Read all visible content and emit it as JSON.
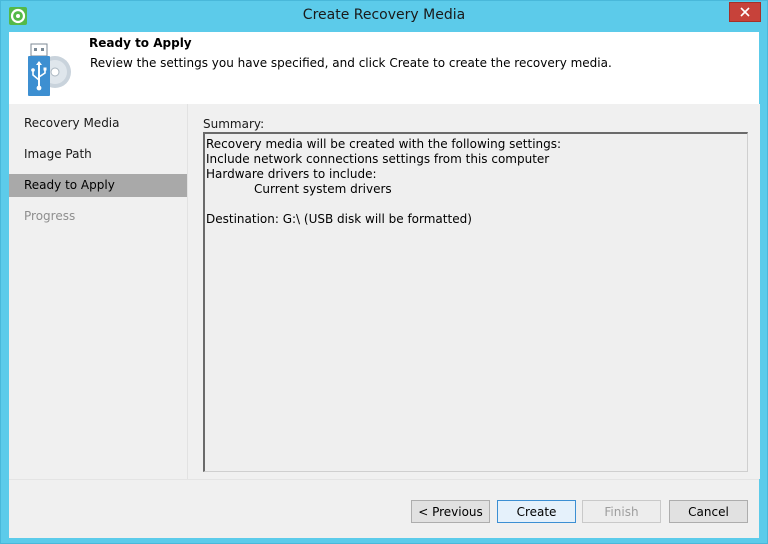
{
  "window": {
    "title": "Create Recovery Media"
  },
  "header": {
    "title": "Ready to Apply",
    "description": "Review the settings you have specified, and click Create to create the recovery media."
  },
  "steps": [
    {
      "label": "Recovery Media",
      "state": "completed"
    },
    {
      "label": "Image Path",
      "state": "completed"
    },
    {
      "label": "Ready to Apply",
      "state": "active"
    },
    {
      "label": "Progress",
      "state": "disabled"
    }
  ],
  "summary": {
    "label": "Summary:",
    "lines": [
      "Recovery media will be created with the following settings:",
      "Include network connections settings from this computer",
      "Hardware drivers to include:",
      "Current system drivers",
      "",
      "Destination: G:\\ (USB disk will be formatted)"
    ]
  },
  "buttons": {
    "previous": "< Previous",
    "create": "Create",
    "finish": "Finish",
    "cancel": "Cancel"
  },
  "colors": {
    "title_bar": "#5ccbea",
    "close_button": "#c7423a",
    "active_step": "#a9a9a9",
    "usb_icon": "#3d8fd1"
  }
}
